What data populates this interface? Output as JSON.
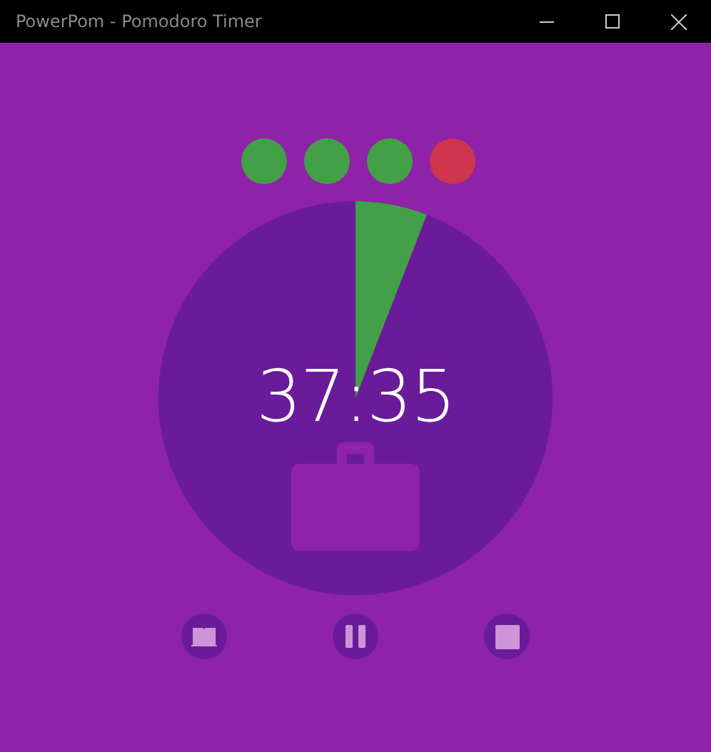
{
  "window": {
    "title": "PowerPom - Pomodoro Timer"
  },
  "sessions": [
    {
      "color": "#43a047"
    },
    {
      "color": "#43a047"
    },
    {
      "color": "#43a047"
    },
    {
      "color": "#d0354e"
    }
  ],
  "timer": {
    "time": "37:35"
  },
  "controls": [
    {
      "kind": "book"
    },
    {
      "kind": "pause"
    },
    {
      "kind": "stop"
    }
  ]
}
